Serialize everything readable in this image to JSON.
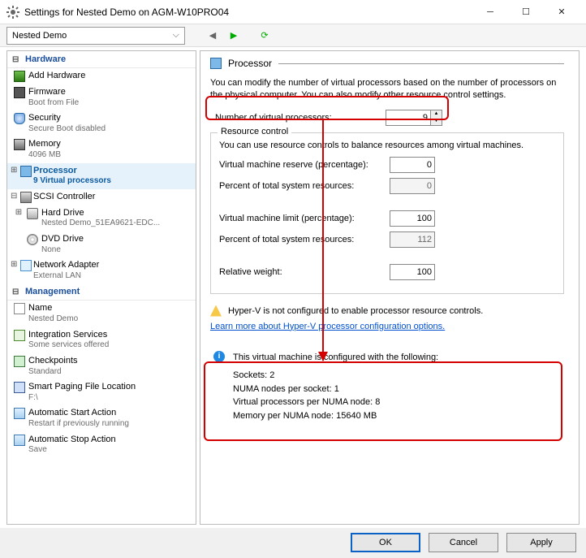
{
  "window": {
    "title": "Settings for Nested Demo on AGM-W10PRO04",
    "vm_selected": "Nested Demo"
  },
  "sidebar": {
    "hardware_header": "Hardware",
    "management_header": "Management",
    "items": {
      "add_hw": "Add Hardware",
      "firmware": "Firmware",
      "firmware_sub": "Boot from File",
      "security": "Security",
      "security_sub": "Secure Boot disabled",
      "memory": "Memory",
      "memory_sub": "4096 MB",
      "processor": "Processor",
      "processor_sub": "9 Virtual processors",
      "scsi": "SCSI Controller",
      "hdd": "Hard Drive",
      "hdd_sub": "Nested Demo_51EA9621-EDC...",
      "dvd": "DVD Drive",
      "dvd_sub": "None",
      "net": "Network Adapter",
      "net_sub": "External LAN",
      "name": "Name",
      "name_sub": "Nested Demo",
      "integ": "Integration Services",
      "integ_sub": "Some services offered",
      "chk": "Checkpoints",
      "chk_sub": "Standard",
      "spf": "Smart Paging File Location",
      "spf_sub": "F:\\",
      "asa": "Automatic Start Action",
      "asa_sub": "Restart if previously running",
      "astop": "Automatic Stop Action",
      "astop_sub": "Save"
    }
  },
  "content": {
    "section": "Processor",
    "desc": "You can modify the number of virtual processors based on the number of processors on the physical computer. You can also modify other resource control settings.",
    "num_vp_label": "Number of virtual processors:",
    "num_vp_value": "9",
    "rc": {
      "legend": "Resource control",
      "desc": "You can use resource controls to balance resources among virtual machines.",
      "vmr_label": "Virtual machine reserve (percentage):",
      "vmr_val": "0",
      "pct1_label": "Percent of total system resources:",
      "pct1_val": "0",
      "vml_label": "Virtual machine limit (percentage):",
      "vml_val": "100",
      "pct2_label": "Percent of total system resources:",
      "pct2_val": "112",
      "rw_label": "Relative weight:",
      "rw_val": "100"
    },
    "warn": "Hyper-V is not configured to enable processor resource controls.",
    "link": "Learn more about Hyper-V processor configuration options.",
    "info_lead": "This virtual machine is configured with the following:",
    "info_lines": {
      "sockets": "Sockets: 2",
      "numa": "NUMA nodes per socket: 1",
      "vpp": "Virtual processors per NUMA node: 8",
      "mem": "Memory per NUMA node: 15640 MB"
    }
  },
  "footer": {
    "ok": "OK",
    "cancel": "Cancel",
    "apply": "Apply"
  }
}
